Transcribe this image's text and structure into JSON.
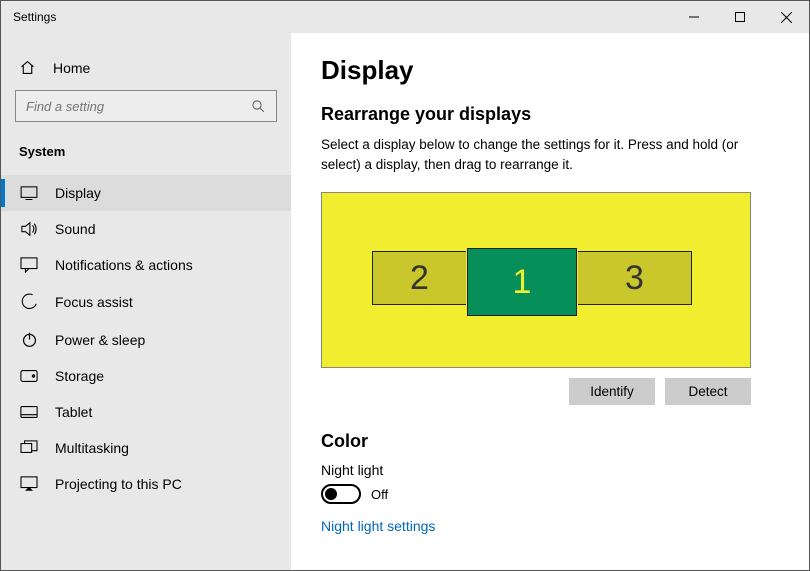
{
  "window": {
    "title": "Settings"
  },
  "sidebar": {
    "home": "Home",
    "search_placeholder": "Find a setting",
    "section": "System",
    "items": [
      {
        "label": "Display"
      },
      {
        "label": "Sound"
      },
      {
        "label": "Notifications & actions"
      },
      {
        "label": "Focus assist"
      },
      {
        "label": "Power & sleep"
      },
      {
        "label": "Storage"
      },
      {
        "label": "Tablet"
      },
      {
        "label": "Multitasking"
      },
      {
        "label": "Projecting to this PC"
      }
    ]
  },
  "main": {
    "title": "Display",
    "rearrange": {
      "heading": "Rearrange your displays",
      "help": "Select a display below to change the settings for it. Press and hold (or select) a display, then drag to rearrange it.",
      "monitors": [
        {
          "id": "1",
          "selected": true
        },
        {
          "id": "2",
          "selected": false
        },
        {
          "id": "3",
          "selected": false
        }
      ],
      "identify": "Identify",
      "detect": "Detect"
    },
    "color": {
      "heading": "Color",
      "night_light_label": "Night light",
      "night_light_state": "Off",
      "night_light_link": "Night light settings"
    }
  }
}
